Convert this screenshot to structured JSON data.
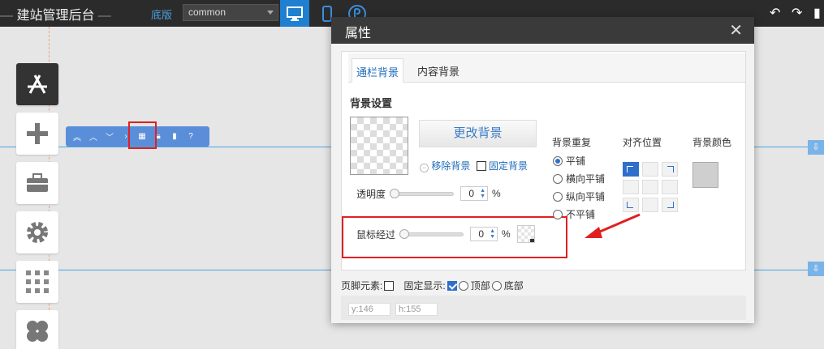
{
  "topbar": {
    "title": "建站管理后台",
    "title_dash_left": "—",
    "title_dash_right": "—",
    "version_label": "底版",
    "version_select_value": "common"
  },
  "toolbar_float": {
    "icons": [
      "collapse-icon",
      "up-icon",
      "down-icon",
      "settings-grid-icon",
      "lock-icon",
      "trash-icon",
      "help-icon"
    ]
  },
  "dialog": {
    "title": "属性",
    "close": "✕",
    "tabs": [
      {
        "label": "通栏背景",
        "active": true
      },
      {
        "label": "内容背景",
        "active": false
      }
    ],
    "section_title": "背景设置",
    "change_bg_button": "更改背景",
    "remove_bg": "移除背景",
    "fixed_bg": "固定背景",
    "opacity": {
      "label": "透明度",
      "value": "0",
      "unit": "%"
    },
    "hover": {
      "label": "鼠标经过",
      "value": "0",
      "unit": "%"
    },
    "repeat": {
      "title": "背景重复",
      "options": [
        "平铺",
        "横向平铺",
        "纵向平铺",
        "不平铺"
      ],
      "selected": "平铺"
    },
    "align_title": "对齐位置",
    "color_title": "背景颜色",
    "color_value": "#cfcfcf",
    "footer": {
      "footer_element_label": "页脚元素:",
      "fixed_show_label": "固定显示:",
      "top_label": "顶部",
      "bottom_label": "底部"
    },
    "coords": {
      "y": "y:146",
      "h": "h:155"
    }
  },
  "colors": {
    "accent": "#1f7fd0",
    "highlight_red": "#e02020",
    "guide_blue": "#4aa3df"
  }
}
